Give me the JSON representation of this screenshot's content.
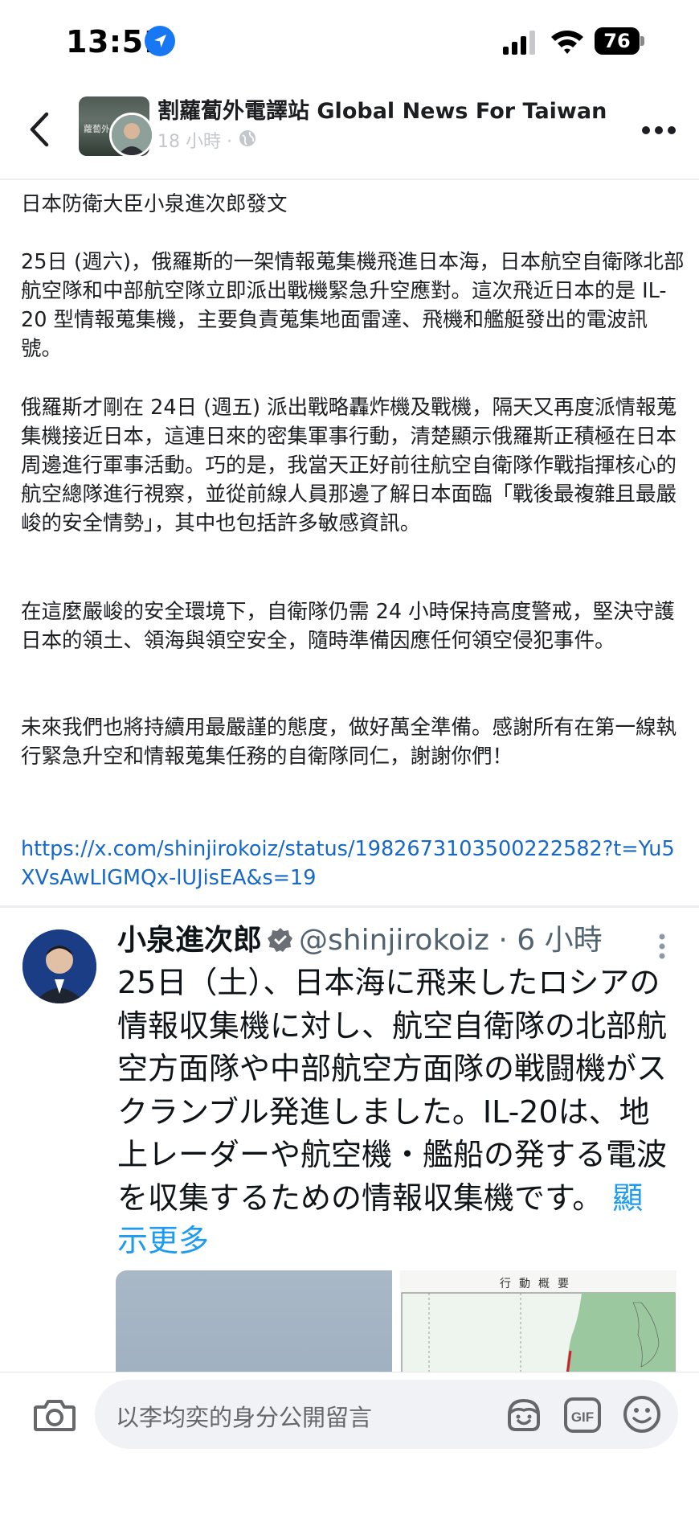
{
  "status_bar": {
    "time": "13:51",
    "battery": "76"
  },
  "header": {
    "page_name": "割蘿蔔外電譯站 Global News For Taiwan",
    "post_time": "18 小時 ·",
    "avatar_text": "蘿蔔外電"
  },
  "post": {
    "title": "日本防衛大臣小泉進次郎發文",
    "paragraphs": [
      "25日 (週六)，俄羅斯的一架情報蒐集機飛進日本海，日本航空自衛隊北部航空隊和中部航空隊立即派出戰機緊急升空應對。這次飛近日本的是 IL-20 型情報蒐集機，主要負責蒐集地面雷達、飛機和艦艇發出的電波訊號。",
      "俄羅斯才剛在 24日 (週五) 派出戰略轟炸機及戰機，隔天又再度派情報蒐集機接近日本，這連日來的密集軍事行動，清楚顯示俄羅斯正積極在日本周邊進行軍事活動。巧的是，我當天正好前往航空自衛隊作戰指揮核心的航空總隊進行視察，並從前線人員那邊了解日本面臨「戰後最複雜且最嚴峻的安全情勢」，其中也包括許多敏感資訊。",
      "在這麼嚴峻的安全環境下，自衛隊仍需 24 小時保持高度警戒，堅決守護日本的領土、領海與領空安全，隨時準備因應任何領空侵犯事件。",
      "未來我們也將持續用最嚴謹的態度，做好萬全準備。感謝所有在第一線執行緊急升空和情報蒐集任務的自衛隊同仁，謝謝你們！"
    ],
    "link": "https://x.com/shinjirokoiz/status/1982673103500222582?t=Yu5XVsAwLIGMQx-lUJisEA&s=19"
  },
  "tweet": {
    "name": "小泉進次郎",
    "handle": "@shinjirokoiz",
    "meta": " · 6 小時",
    "text": "25日（土）、日本海に飛来したロシアの情報収集機に対し、航空自衛隊の北部航空方面隊や中部航空方面隊の戦闘機がスクランブル発進しました。IL-20は、地上レーダーや航空機・艦船の発する電波を収集するための情報収集機です。",
    "show_more": "顯示更多",
    "image_title": "行動概要"
  },
  "comment_bar": {
    "placeholder": "以李均奕的身分公開留言",
    "gif_label": "GIF"
  },
  "colors": {
    "link": "#1668c8",
    "accent": "#1877f2",
    "tweet_link": "#1d9bf0"
  },
  "icons": [
    "location-arrow-icon",
    "signal-icon",
    "wifi-icon",
    "battery-icon",
    "back-chevron-icon",
    "globe-icon",
    "more-icon",
    "verified-icon",
    "camera-icon",
    "avatar-sticker-icon",
    "gif-icon",
    "emoji-icon"
  ]
}
